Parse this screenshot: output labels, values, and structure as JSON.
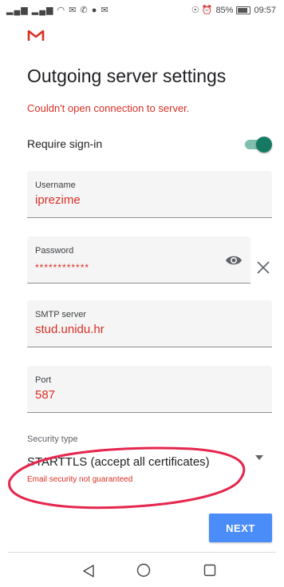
{
  "status_bar": {
    "left_icons": "▂▄▆ ▂▄▆ ◠ ✉ ✆ ● ✉",
    "right_icons": "☉ ⏰",
    "battery": "85%",
    "battery_fraction": 0.85,
    "time": "09:57"
  },
  "app": {
    "logo_icon": "gmail-logo"
  },
  "page": {
    "title": "Outgoing server settings",
    "error": "Couldn't open connection to server."
  },
  "require_signin": {
    "label": "Require sign-in",
    "enabled": true
  },
  "username": {
    "label": "Username",
    "value": "iprezime"
  },
  "password": {
    "label": "Password",
    "value": "************"
  },
  "smtp": {
    "label": "SMTP server",
    "value": "stud.unidu.hr"
  },
  "port": {
    "label": "Port",
    "value": "587"
  },
  "security": {
    "label": "Security type",
    "value": "STARTTLS (accept all certificates)",
    "warning": "Email security not guaranteed"
  },
  "next_button": {
    "label": "NEXT"
  },
  "colors": {
    "accent": "#4a8df8",
    "error": "#d93025",
    "toggle_on": "#167a62",
    "annotation": "#e5264d"
  },
  "icons": [
    "gmail-logo",
    "eye-icon",
    "clear-icon",
    "dropdown-arrow-icon",
    "back-icon",
    "home-icon",
    "recent-apps-icon"
  ]
}
